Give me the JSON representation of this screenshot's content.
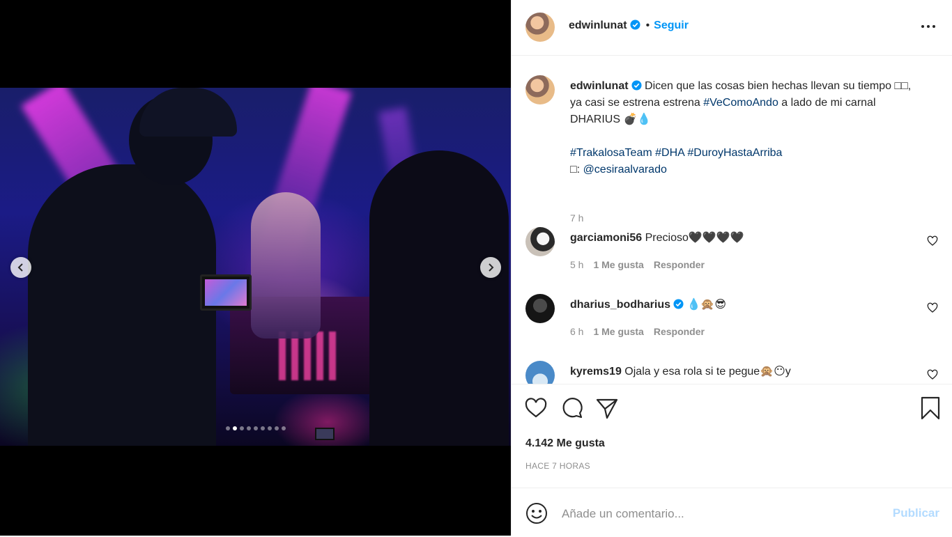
{
  "post": {
    "username": "edwinlunat",
    "follow_label": "Seguir",
    "bullet": "•",
    "caption": {
      "username": "edwinlunat",
      "line1": "Dicen que las cosas bien hechas llevan su tiempo □□,",
      "line2_pre": "ya casi se estrena estrena ",
      "line2_tag": "#VeComoAndo",
      "line2_post": " a lado de mi carnal",
      "line3": "DHARIUS 💣💧",
      "tags": [
        "#TrakalosaTeam",
        "#DHA",
        "#DuroyHastaArriba"
      ],
      "credit_prefix": "□: ",
      "credit_handle": "@cesiraalvarado",
      "time": "7 h"
    },
    "comments": [
      {
        "username": "garciamoni56",
        "text": "Precioso🖤🖤🖤🖤",
        "time": "5 h",
        "likes": "1 Me gusta",
        "reply": "Responder",
        "verified": false
      },
      {
        "username": "dharius_bodharius",
        "text": "💧🙊😎",
        "time": "6 h",
        "likes": "1 Me gusta",
        "reply": "Responder",
        "verified": true
      },
      {
        "username": "kyrems19",
        "text": "Ojala y esa rola si te pegue🙊😶y",
        "verified": false
      }
    ],
    "likes_count": "4.142 Me gusta",
    "posted_ago": "HACE 7 HORAS",
    "comment_placeholder": "Añade un comentario...",
    "publish_label": "Publicar",
    "carousel": {
      "total": 9,
      "active_index": 1
    }
  },
  "colors": {
    "accent": "#0095f6",
    "hashtag": "#00376b",
    "muted": "#8e8e8e",
    "publish_disabled": "#b3dbff"
  },
  "icons": [
    "verified-badge-icon",
    "more-options-icon",
    "heart-icon",
    "comment-icon",
    "share-icon",
    "bookmark-icon",
    "emoji-icon",
    "chevron-left-icon",
    "chevron-right-icon"
  ]
}
